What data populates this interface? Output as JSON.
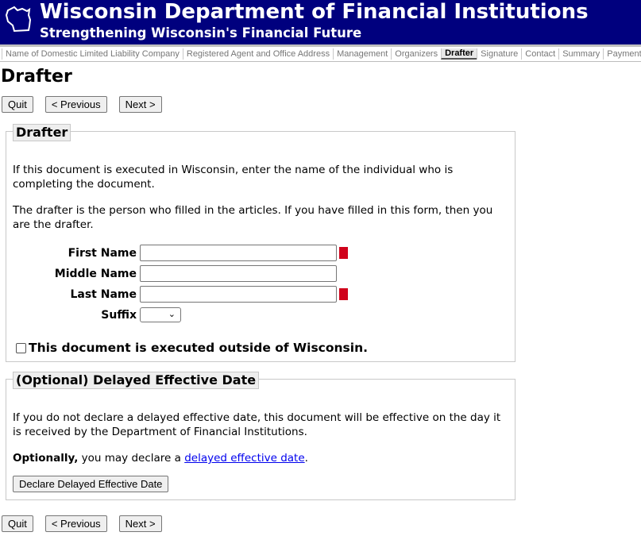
{
  "banner": {
    "logo_icon": "wisconsin-outline-icon",
    "title": "Wisconsin Department of Financial Institutions",
    "subtitle": "Strengthening Wisconsin's Financial Future"
  },
  "nav": {
    "items": [
      {
        "label": "Name of Domestic Limited Liability Company",
        "active": false
      },
      {
        "label": "Registered Agent and Office Address",
        "active": false
      },
      {
        "label": "Management",
        "active": false
      },
      {
        "label": "Organizers",
        "active": false
      },
      {
        "label": "Drafter",
        "active": true
      },
      {
        "label": "Signature",
        "active": false
      },
      {
        "label": "Contact",
        "active": false
      },
      {
        "label": "Summary",
        "active": false
      },
      {
        "label": "Payment",
        "active": false
      }
    ]
  },
  "page": {
    "title": "Drafter"
  },
  "buttons": {
    "quit": "Quit",
    "previous": "< Previous",
    "next": "Next >"
  },
  "drafter_section": {
    "legend": "Drafter",
    "para1": "If this document is executed in Wisconsin, enter the name of the individual who is completing the document.",
    "para2": "The drafter is the person who filled in the articles. If you have filled in this form, then you are the drafter.",
    "fields": {
      "first_name": {
        "label": "First Name",
        "value": "",
        "required": true
      },
      "middle_name": {
        "label": "Middle Name",
        "value": "",
        "required": false
      },
      "last_name": {
        "label": "Last Name",
        "value": "",
        "required": true
      },
      "suffix": {
        "label": "Suffix",
        "value": ""
      }
    },
    "outside_checkbox": {
      "label": "This document is executed outside of Wisconsin.",
      "checked": false
    }
  },
  "delayed_section": {
    "legend": "(Optional) Delayed Effective Date",
    "para1": "If you do not declare a delayed effective date, this document will be effective on the day it is received by the Department of Financial Institutions.",
    "optional_bold": "Optionally,",
    "optional_text": " you may declare a ",
    "link_text": "delayed effective date",
    "period": ".",
    "declare_button": "Declare Delayed Effective Date"
  },
  "colors": {
    "banner_bg": "#00007e",
    "required_marker": "#d0021b",
    "link": "#0000ee"
  }
}
